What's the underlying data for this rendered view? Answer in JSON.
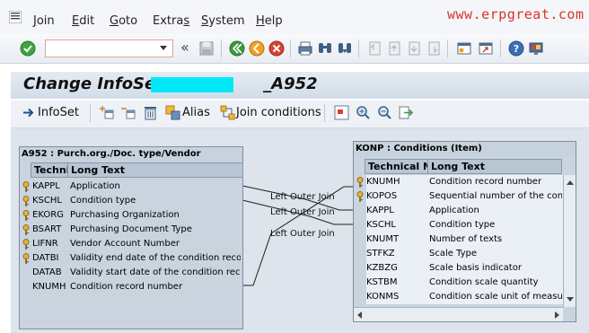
{
  "menu": {
    "items": [
      {
        "label": "Join",
        "u": "J",
        "rest": "oin"
      },
      {
        "label": "Edit",
        "u": "E",
        "rest": "dit"
      },
      {
        "label": "Goto",
        "u": "G",
        "rest": "oto"
      },
      {
        "label": "Extras",
        "u": "",
        "pre": "Extra",
        "post": "s"
      },
      {
        "label": "System",
        "u": "S",
        "rest": "ystem"
      },
      {
        "label": "Help",
        "u": "H",
        "rest": "elp"
      }
    ]
  },
  "watermark": "www.erpgreat.com",
  "command_field": {
    "value": ""
  },
  "title": {
    "prefix": "Change InfoSet Z",
    "suffix": "_A952"
  },
  "app_toolbar": {
    "infoset_label": "InfoSet",
    "alias_label": "Alias",
    "join_conditions_label": "Join conditions"
  },
  "left_table": {
    "title": "A952 : Purch.org./Doc. type/Vendor",
    "col_tech": "Technical Name",
    "col_long": "Long Text",
    "rows": [
      {
        "field": "KAPPL",
        "text": "Application",
        "key": true
      },
      {
        "field": "KSCHL",
        "text": "Condition type",
        "key": true
      },
      {
        "field": "EKORG",
        "text": "Purchasing Organization",
        "key": true
      },
      {
        "field": "BSART",
        "text": "Purchasing Document Type",
        "key": true
      },
      {
        "field": "LIFNR",
        "text": "Vendor Account Number",
        "key": true
      },
      {
        "field": "DATBI",
        "text": "Validity end date of the condition record",
        "key": true
      },
      {
        "field": "DATAB",
        "text": "Validity start date of the condition record",
        "key": false
      },
      {
        "field": "KNUMH",
        "text": "Condition record number",
        "key": false
      }
    ]
  },
  "right_table": {
    "title": "KONP : Conditions (Item)",
    "col_tech": "Technical Name",
    "col_long": "Long Text",
    "rows": [
      {
        "field": "KNUMH",
        "text": "Condition record number",
        "key": true
      },
      {
        "field": "KOPOS",
        "text": "Sequential number of the condition",
        "key": true
      },
      {
        "field": "KAPPL",
        "text": "Application",
        "key": false
      },
      {
        "field": "KSCHL",
        "text": "Condition type",
        "key": false
      },
      {
        "field": "KNUMT",
        "text": "Number of texts",
        "key": false
      },
      {
        "field": "STFKZ",
        "text": "Scale Type",
        "key": false
      },
      {
        "field": "KZBZG",
        "text": "Scale basis indicator",
        "key": false
      },
      {
        "field": "KSTBM",
        "text": "Condition scale quantity",
        "key": false
      },
      {
        "field": "KONMS",
        "text": "Condition scale unit of measure",
        "key": false
      }
    ]
  },
  "joins": [
    {
      "label": "Left Outer Join"
    },
    {
      "label": "Left Outer Join"
    },
    {
      "label": "Left Outer Join"
    }
  ],
  "colors": {
    "title_mask": "#00e8f6",
    "watermark": "#d8342c",
    "canvas": "#dde4ec"
  }
}
